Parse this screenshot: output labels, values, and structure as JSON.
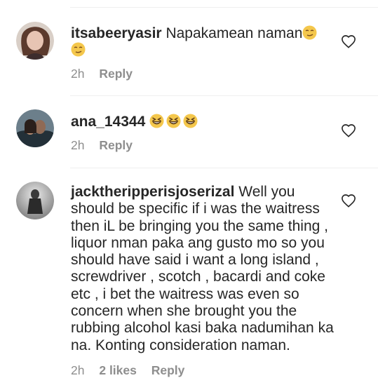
{
  "comments": [
    {
      "username": "itsabeeryasir",
      "text": "Napakamean naman",
      "emoji": [
        "smirk-emoji",
        "smirk-emoji"
      ],
      "time": "2h",
      "likes": "",
      "reply": "Reply"
    },
    {
      "username": "ana_14344",
      "text": "",
      "emoji": [
        "grinning-squinting-emoji",
        "grinning-squinting-emoji",
        "grinning-squinting-emoji"
      ],
      "time": "2h",
      "likes": "",
      "reply": "Reply"
    },
    {
      "username": "jacktheripperisjoserizal",
      "text": "Well you should be specific if i was the waitress then iL be bringing you the same thing , liquor nman paka ang gusto mo so you should have said i want a long island , screwdriver , scotch , bacardi and coke etc , i bet the waitress was even so concern when she brought you the rubbing alcohol kasi baka nadumihan ka na. Konting consideration naman.",
      "emoji": [],
      "time": "2h",
      "likes": "2 likes",
      "reply": "Reply"
    }
  ],
  "icons": {
    "like": "heart-outline-icon"
  },
  "colors": {
    "text": "#262626",
    "meta": "#8e8e8e",
    "divider": "#efefef",
    "emoji": "#f4c74c"
  }
}
